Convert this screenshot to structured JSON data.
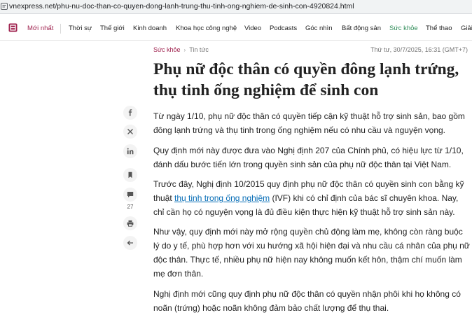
{
  "browser": {
    "url": "vnexpress.net/phu-nu-doc-than-co-quyen-dong-lanh-trung-thu-tinh-ong-nghiem-de-sinh-con-4920824.html"
  },
  "nav": {
    "newest": "Mới nhất",
    "items": [
      "Thời sự",
      "Thế giới",
      "Kinh doanh",
      "Khoa học công nghệ",
      "Video",
      "Podcasts",
      "Góc nhìn",
      "Bất động sản",
      "Sức khỏe",
      "Thể thao",
      "Giải"
    ],
    "active": "Sức khỏe",
    "active_color": "#2e8b57",
    "brand_color": "#9f224e"
  },
  "article": {
    "breadcrumb": [
      "Sức khỏe",
      "Tin tức"
    ],
    "date": "Thứ tư, 30/7/2025, 16:31 (GMT+7)",
    "title": "Phụ nữ độc thân có quyền đông lạnh trứng, thụ tinh ống nghiệm để sinh con",
    "p1": "Từ ngày 1/10, phụ nữ độc thân có quyền tiếp cận kỹ thuật hỗ trợ sinh sản, bao gồm đông lạnh trứng và thụ tinh trong ống nghiệm nếu có nhu cầu và nguyện vọng.",
    "p2": "Quy định mới này được đưa vào Nghị định 207 của Chính phủ, có hiệu lực từ 1/10, đánh dấu bước tiến lớn trong quyền sinh sản của phụ nữ độc thân tại Việt Nam.",
    "p3_before": "Trước đây, Nghị định 10/2015 quy định phụ nữ độc thân có quyền sinh con bằng kỹ thuật ",
    "p3_link": "thụ tinh trong ống nghiệm",
    "p3_after": " (IVF) khi có chỉ định của bác sĩ chuyên khoa. Nay, chỉ cần họ có nguyện vọng là đủ điều kiện thực hiện kỹ thuật hỗ trợ sinh sản này.",
    "p4": "Như vậy, quy định mới này mở rộng quyền chủ động làm mẹ, không còn ràng buộc lý do y tế, phù hợp hơn với xu hướng xã hội hiện đại và nhu cầu cá nhân của phụ nữ độc thân. Thực tế, nhiều phụ nữ hiện nay không muốn kết hôn, thậm chí muốn làm mẹ đơn thân.",
    "p5": "Nghị định mới cũng quy định phụ nữ độc thân có quyền nhận phôi khi họ không có noãn (trứng) hoặc noãn không đảm bảo chất lượng để thụ thai."
  },
  "social": {
    "icons": [
      "facebook-icon",
      "x-icon",
      "linkedin-icon",
      "bookmark-icon",
      "comment-icon",
      "print-icon",
      "back-icon"
    ],
    "comment_count": "27"
  }
}
